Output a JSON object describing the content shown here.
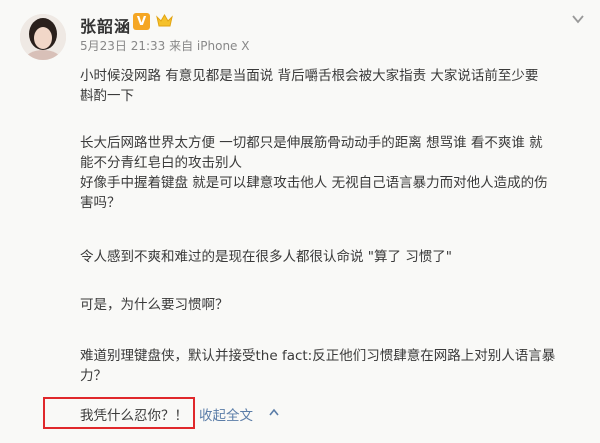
{
  "post": {
    "author": "张韶涵",
    "vip_badge": "V",
    "meta": "5月23日 21:33 来自 iPhone X",
    "paragraphs": {
      "p1": "小时候没网路 有意见都是当面说 背后嚼舌根会被大家指责 大家说话前至少要",
      "p1b": "斟酌一下",
      "p2": "长大后网路世界太方便 一切都只是伸展筋骨动动手的距离 想骂谁 看不爽谁 就",
      "p2b": "能不分青红皂白的攻击别人",
      "p2c": "好像手中握着键盘 就是可以肆意攻击他人 无视自己语言暴力而对他人造成的伤",
      "p2d": "害吗？",
      "p3": "令人感到不爽和难过的是现在很多人都很认命说 \"算了 习惯了\"",
      "p4": "可是，为什么要习惯啊？",
      "p5": "难道别理键盘侠，默认并接受the fact:反正他们习惯肆意在网路上对别人语言暴",
      "p5b": "力？"
    },
    "last_line": "我凭什么忍你？！",
    "collapse_label": "收起全文"
  },
  "icons": {
    "avatar": "avatar-photo",
    "vip": "vip-badge-icon",
    "crown": "crown-icon",
    "menu": "chevron-down-icon",
    "collapse": "chevron-up-icon"
  },
  "colors": {
    "link": "#5b7da8",
    "highlight": "#e0282b",
    "vip": "#f5a623"
  }
}
